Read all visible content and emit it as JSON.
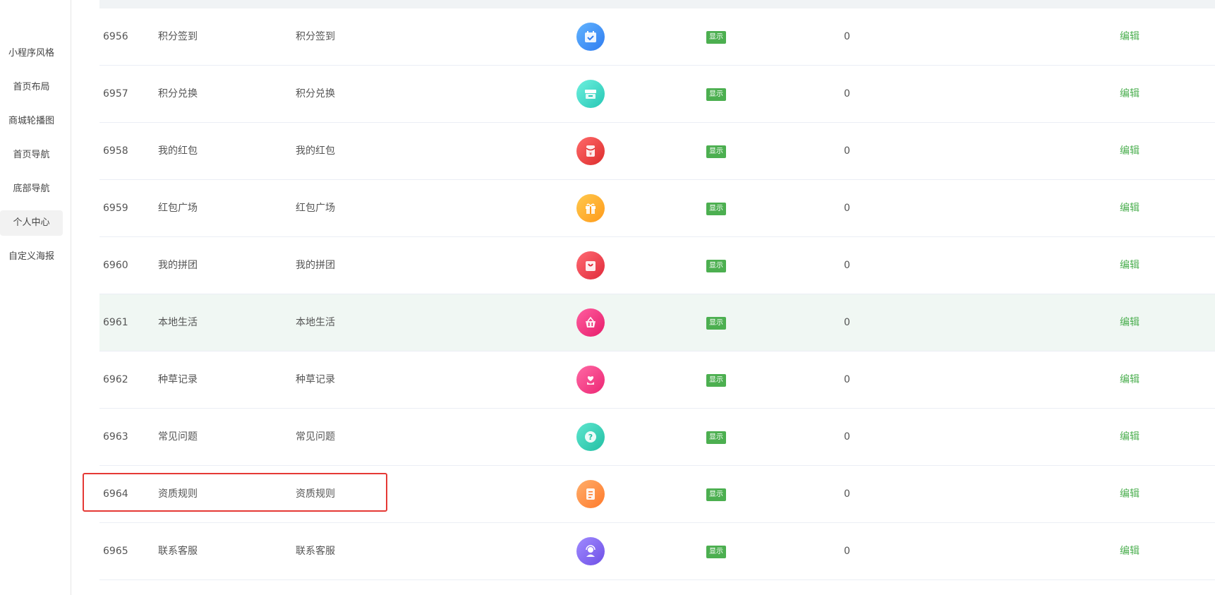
{
  "sidebar": {
    "items": [
      {
        "label": "小程序风格",
        "active": false
      },
      {
        "label": "首页布局",
        "active": false
      },
      {
        "label": "商城轮播图",
        "active": false
      },
      {
        "label": "首页导航",
        "active": false
      },
      {
        "label": "底部导航",
        "active": false
      },
      {
        "label": "个人中心",
        "active": true
      },
      {
        "label": "自定义海报",
        "active": false
      }
    ]
  },
  "table": {
    "rows": [
      {
        "id": "6956",
        "name": "积分签到",
        "title": "积分签到",
        "icon": "calendar-check-icon",
        "icon_color": "#3b8cf5",
        "status": "显示",
        "sort": "0",
        "action": "编辑"
      },
      {
        "id": "6957",
        "name": "积分兑换",
        "title": "积分兑换",
        "icon": "exchange-store-icon",
        "icon_color": "#34d1c0",
        "status": "显示",
        "sort": "0",
        "action": "编辑"
      },
      {
        "id": "6958",
        "name": "我的红包",
        "title": "我的红包",
        "icon": "red-envelope-icon",
        "icon_color": "#ee3f3f",
        "status": "显示",
        "sort": "0",
        "action": "编辑"
      },
      {
        "id": "6959",
        "name": "红包广场",
        "title": "红包广场",
        "icon": "gift-icon",
        "icon_color": "#ffa826",
        "status": "显示",
        "sort": "0",
        "action": "编辑"
      },
      {
        "id": "6960",
        "name": "我的拼团",
        "title": "我的拼团",
        "icon": "shopping-bag-icon",
        "icon_color": "#ee3f4a",
        "status": "显示",
        "sort": "0",
        "action": "编辑"
      },
      {
        "id": "6961",
        "name": "本地生活",
        "title": "本地生活",
        "icon": "basket-icon",
        "icon_color": "#f4317a",
        "status": "显示",
        "sort": "0",
        "action": "编辑"
      },
      {
        "id": "6962",
        "name": "种草记录",
        "title": "种草记录",
        "icon": "heart-plant-icon",
        "icon_color": "#f6357d",
        "status": "显示",
        "sort": "0",
        "action": "编辑"
      },
      {
        "id": "6963",
        "name": "常见问题",
        "title": "常见问题",
        "icon": "question-icon",
        "icon_color": "#2fcfb2",
        "status": "显示",
        "sort": "0",
        "action": "编辑"
      },
      {
        "id": "6964",
        "name": "资质规则",
        "title": "资质规则",
        "icon": "document-icon",
        "icon_color": "#ff8a3d",
        "status": "显示",
        "sort": "0",
        "action": "编辑"
      },
      {
        "id": "6965",
        "name": "联系客服",
        "title": "联系客服",
        "icon": "customer-service-icon",
        "icon_color": "#7a5cf0",
        "status": "显示",
        "sort": "0",
        "action": "编辑"
      }
    ]
  },
  "colors": {
    "accent": "#4caf50",
    "highlight": "#e53935",
    "hover_row": "#f0f7f3"
  }
}
